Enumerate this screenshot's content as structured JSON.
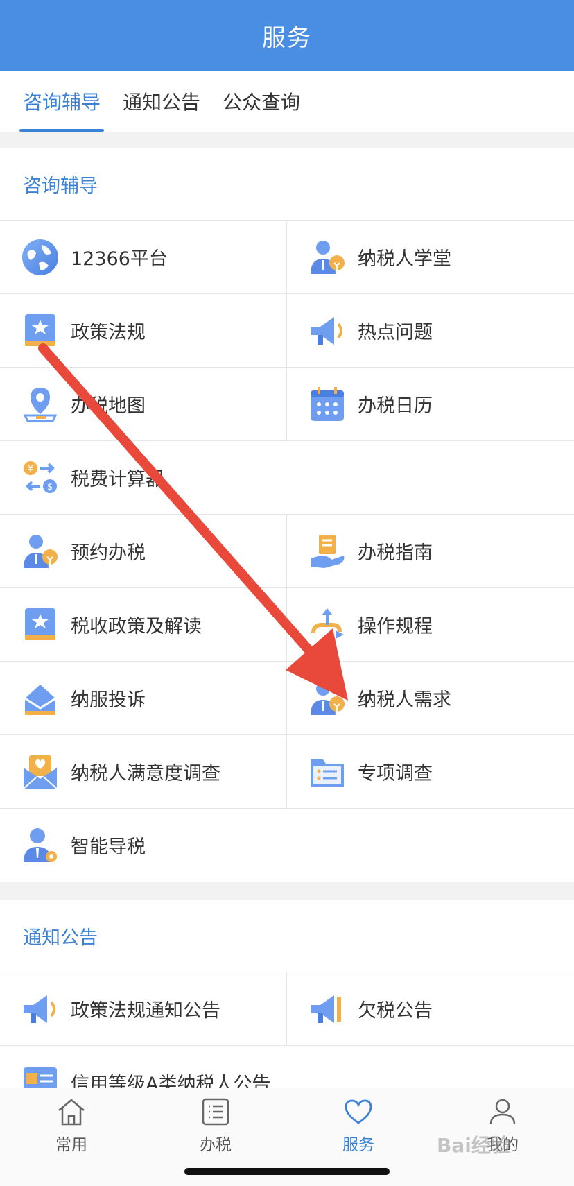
{
  "header": {
    "title": "服务"
  },
  "tabs": [
    {
      "label": "咨询辅导",
      "active": true
    },
    {
      "label": "通知公告",
      "active": false
    },
    {
      "label": "公众查询",
      "active": false
    }
  ],
  "section1": {
    "title": "咨询辅导",
    "items": [
      {
        "label": "12366平台",
        "icon": "globe-icon"
      },
      {
        "label": "纳税人学堂",
        "icon": "person-bulb-icon"
      },
      {
        "label": "政策法规",
        "icon": "star-book-icon"
      },
      {
        "label": "热点问题",
        "icon": "megaphone-icon"
      },
      {
        "label": "办税地图",
        "icon": "map-pin-icon"
      },
      {
        "label": "办税日历",
        "icon": "calendar-icon"
      },
      {
        "label": "税费计算器",
        "icon": "currency-exchange-icon"
      },
      {
        "label": "预约办税",
        "icon": "person-bulb-icon"
      },
      {
        "label": "办税指南",
        "icon": "hand-document-icon"
      },
      {
        "label": "税收政策及解读",
        "icon": "star-book-icon"
      },
      {
        "label": "操作规程",
        "icon": "flow-arrow-icon"
      },
      {
        "label": "纳服投诉",
        "icon": "envelope-icon"
      },
      {
        "label": "纳税人需求",
        "icon": "person-bulb-icon"
      },
      {
        "label": "纳税人满意度调查",
        "icon": "heart-mail-icon"
      },
      {
        "label": "专项调查",
        "icon": "folder-list-icon"
      },
      {
        "label": "智能导税",
        "icon": "person-gear-icon"
      }
    ]
  },
  "section2": {
    "title": "通知公告",
    "items": [
      {
        "label": "政策法规通知公告",
        "icon": "megaphone-icon"
      },
      {
        "label": "欠税公告",
        "icon": "megaphone-icon"
      },
      {
        "label": "信用等级A类纳税人公告",
        "icon": "credit-doc-icon"
      }
    ]
  },
  "tabbar": [
    {
      "label": "常用",
      "icon": "home-icon",
      "active": false
    },
    {
      "label": "办税",
      "icon": "list-icon",
      "active": false
    },
    {
      "label": "服务",
      "icon": "heart-icon",
      "active": true
    },
    {
      "label": "我的",
      "icon": "user-icon",
      "active": false
    }
  ],
  "colors": {
    "header": "#4a8ee3",
    "accent": "#3b82d6",
    "annotation_arrow": "#e8493a"
  },
  "watermark": "Bai经验"
}
